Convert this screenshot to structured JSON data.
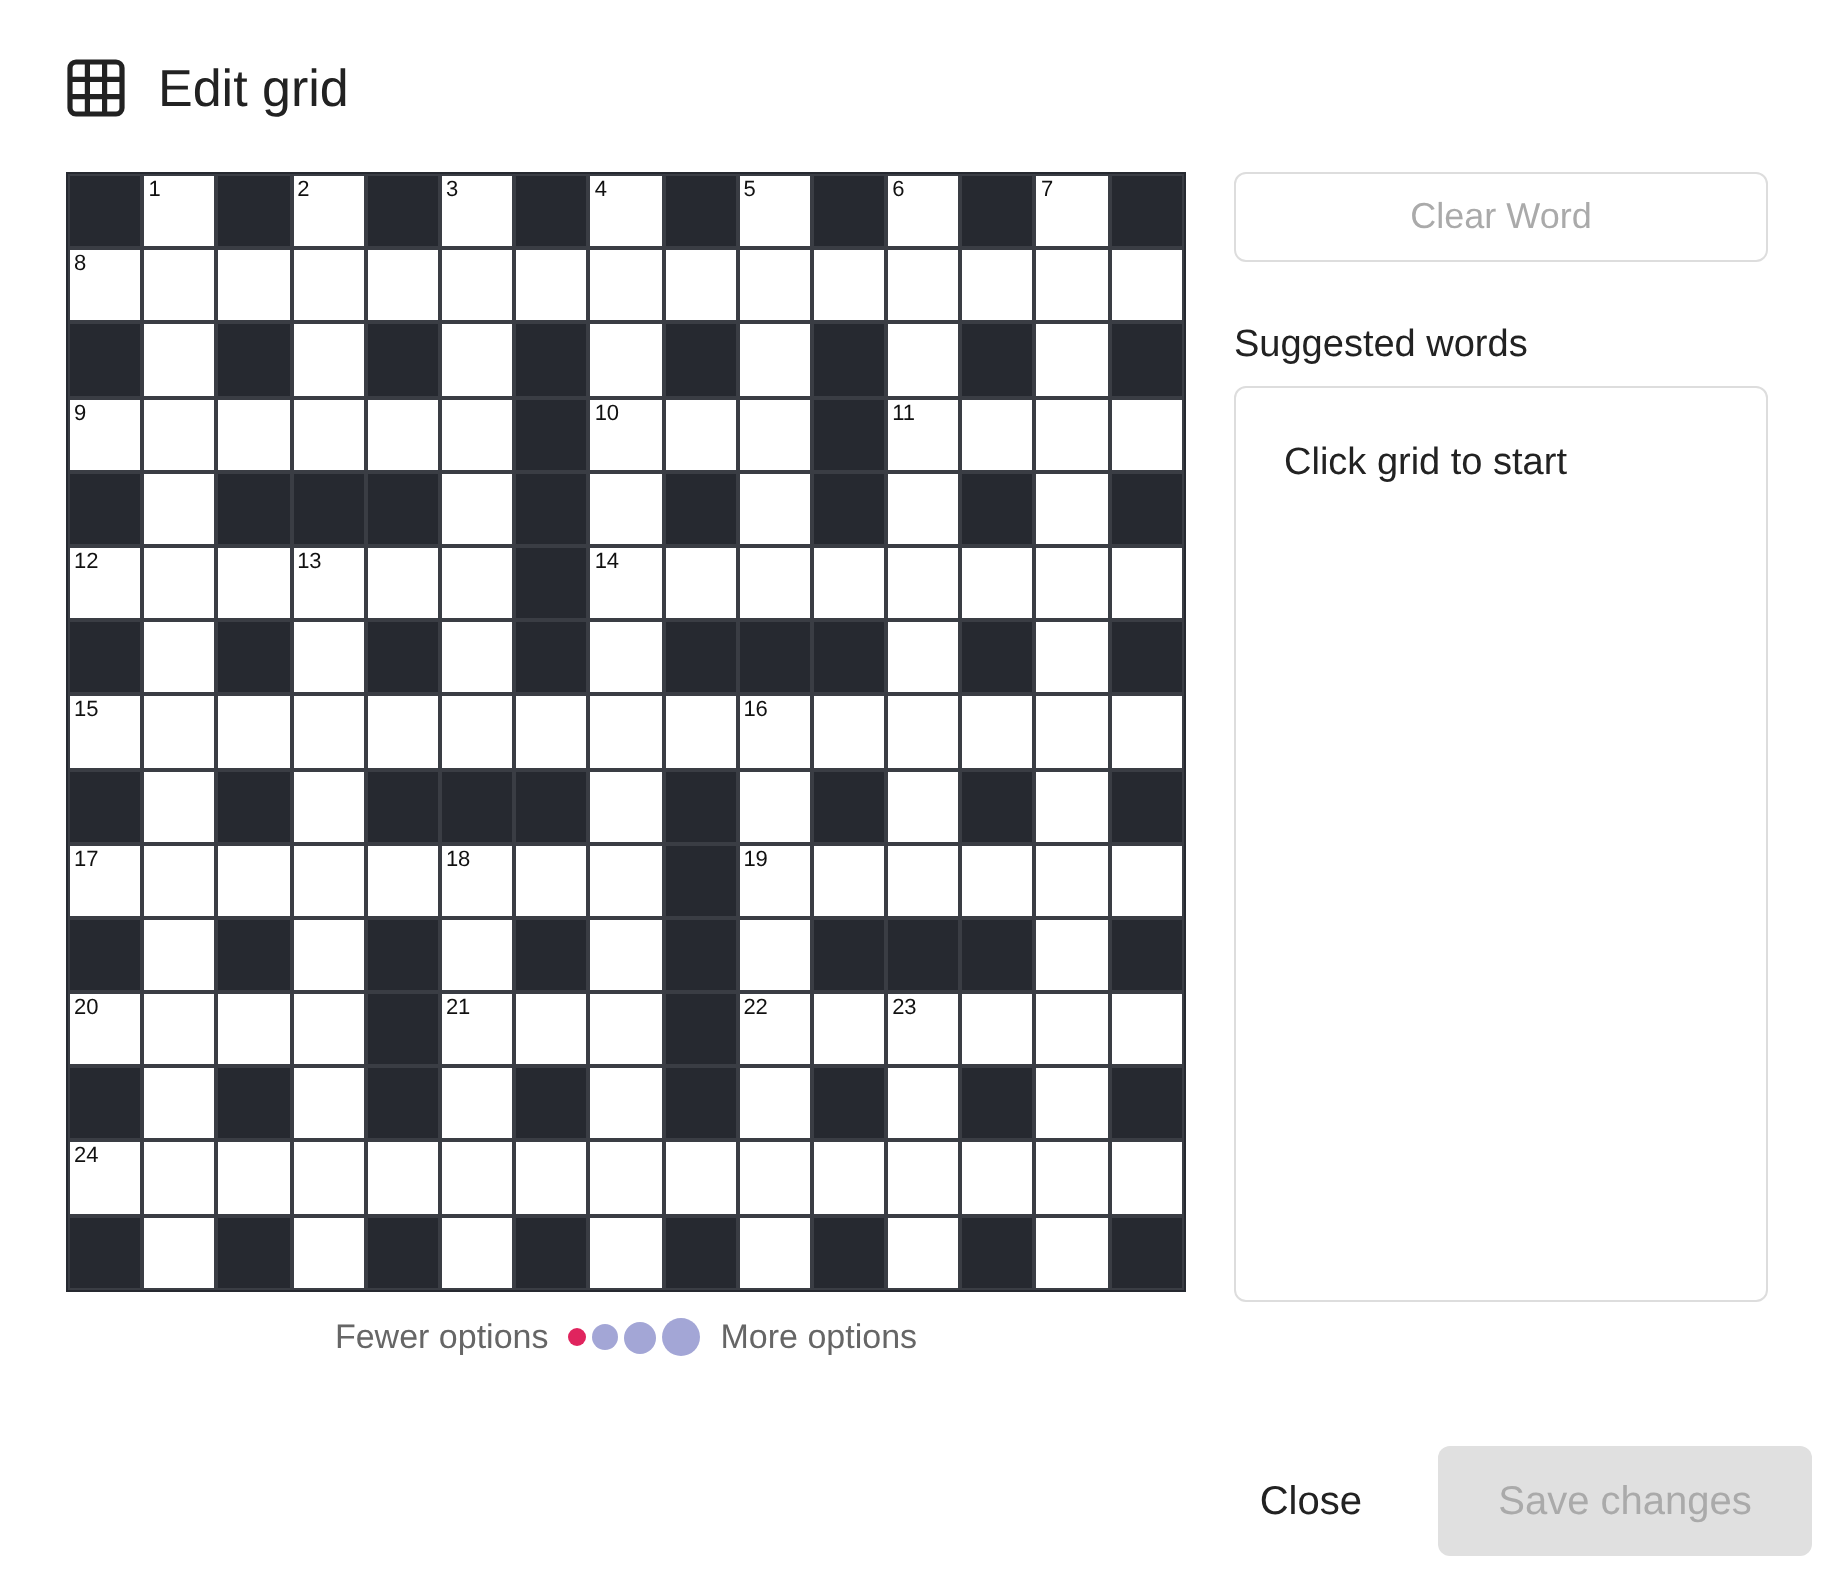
{
  "dialog": {
    "title": "Edit grid"
  },
  "grid": {
    "rows": [
      {
        "cells": [
          {
            "black": true
          },
          {
            "black": false,
            "number": "1"
          },
          {
            "black": true
          },
          {
            "black": false,
            "number": "2"
          },
          {
            "black": true
          },
          {
            "black": false,
            "number": "3"
          },
          {
            "black": true
          },
          {
            "black": false,
            "number": "4"
          },
          {
            "black": true
          },
          {
            "black": false,
            "number": "5"
          },
          {
            "black": true
          },
          {
            "black": false,
            "number": "6"
          },
          {
            "black": true
          },
          {
            "black": false,
            "number": "7"
          },
          {
            "black": true
          }
        ]
      },
      {
        "cells": [
          {
            "black": false,
            "number": "8"
          },
          {
            "black": false
          },
          {
            "black": false
          },
          {
            "black": false
          },
          {
            "black": false
          },
          {
            "black": false
          },
          {
            "black": false
          },
          {
            "black": false
          },
          {
            "black": false
          },
          {
            "black": false
          },
          {
            "black": false
          },
          {
            "black": false
          },
          {
            "black": false
          },
          {
            "black": false
          },
          {
            "black": false
          }
        ]
      },
      {
        "cells": [
          {
            "black": true
          },
          {
            "black": false
          },
          {
            "black": true
          },
          {
            "black": false
          },
          {
            "black": true
          },
          {
            "black": false
          },
          {
            "black": true
          },
          {
            "black": false
          },
          {
            "black": true
          },
          {
            "black": false
          },
          {
            "black": true
          },
          {
            "black": false
          },
          {
            "black": true
          },
          {
            "black": false
          },
          {
            "black": true
          }
        ]
      },
      {
        "cells": [
          {
            "black": false,
            "number": "9"
          },
          {
            "black": false
          },
          {
            "black": false
          },
          {
            "black": false
          },
          {
            "black": false
          },
          {
            "black": false
          },
          {
            "black": true
          },
          {
            "black": false,
            "number": "10"
          },
          {
            "black": false
          },
          {
            "black": false
          },
          {
            "black": true
          },
          {
            "black": false,
            "number": "11"
          },
          {
            "black": false
          },
          {
            "black": false
          },
          {
            "black": false
          }
        ]
      },
      {
        "cells": [
          {
            "black": true
          },
          {
            "black": false
          },
          {
            "black": true
          },
          {
            "black": true
          },
          {
            "black": true
          },
          {
            "black": false
          },
          {
            "black": true
          },
          {
            "black": false
          },
          {
            "black": true
          },
          {
            "black": false
          },
          {
            "black": true
          },
          {
            "black": false
          },
          {
            "black": true
          },
          {
            "black": false
          },
          {
            "black": true
          }
        ]
      },
      {
        "cells": [
          {
            "black": false,
            "number": "12"
          },
          {
            "black": false
          },
          {
            "black": false
          },
          {
            "black": false,
            "number": "13"
          },
          {
            "black": false
          },
          {
            "black": false
          },
          {
            "black": true
          },
          {
            "black": false,
            "number": "14"
          },
          {
            "black": false
          },
          {
            "black": false
          },
          {
            "black": false
          },
          {
            "black": false
          },
          {
            "black": false
          },
          {
            "black": false
          },
          {
            "black": false
          }
        ]
      },
      {
        "cells": [
          {
            "black": true
          },
          {
            "black": false
          },
          {
            "black": true
          },
          {
            "black": false
          },
          {
            "black": true
          },
          {
            "black": false
          },
          {
            "black": true
          },
          {
            "black": false
          },
          {
            "black": true
          },
          {
            "black": true
          },
          {
            "black": true
          },
          {
            "black": false
          },
          {
            "black": true
          },
          {
            "black": false
          },
          {
            "black": true
          }
        ]
      },
      {
        "cells": [
          {
            "black": false,
            "number": "15"
          },
          {
            "black": false
          },
          {
            "black": false
          },
          {
            "black": false
          },
          {
            "black": false
          },
          {
            "black": false
          },
          {
            "black": false
          },
          {
            "black": false
          },
          {
            "black": false
          },
          {
            "black": false,
            "number": "16"
          },
          {
            "black": false
          },
          {
            "black": false
          },
          {
            "black": false
          },
          {
            "black": false
          },
          {
            "black": false
          }
        ]
      },
      {
        "cells": [
          {
            "black": true
          },
          {
            "black": false
          },
          {
            "black": true
          },
          {
            "black": false
          },
          {
            "black": true
          },
          {
            "black": true
          },
          {
            "black": true
          },
          {
            "black": false
          },
          {
            "black": true
          },
          {
            "black": false
          },
          {
            "black": true
          },
          {
            "black": false
          },
          {
            "black": true
          },
          {
            "black": false
          },
          {
            "black": true
          }
        ]
      },
      {
        "cells": [
          {
            "black": false,
            "number": "17"
          },
          {
            "black": false
          },
          {
            "black": false
          },
          {
            "black": false
          },
          {
            "black": false
          },
          {
            "black": false,
            "number": "18"
          },
          {
            "black": false
          },
          {
            "black": false
          },
          {
            "black": true
          },
          {
            "black": false,
            "number": "19"
          },
          {
            "black": false
          },
          {
            "black": false
          },
          {
            "black": false
          },
          {
            "black": false
          },
          {
            "black": false
          }
        ]
      },
      {
        "cells": [
          {
            "black": true
          },
          {
            "black": false
          },
          {
            "black": true
          },
          {
            "black": false
          },
          {
            "black": true
          },
          {
            "black": false
          },
          {
            "black": true
          },
          {
            "black": false
          },
          {
            "black": true
          },
          {
            "black": false
          },
          {
            "black": true
          },
          {
            "black": true
          },
          {
            "black": true
          },
          {
            "black": false
          },
          {
            "black": true
          }
        ]
      },
      {
        "cells": [
          {
            "black": false,
            "number": "20"
          },
          {
            "black": false
          },
          {
            "black": false
          },
          {
            "black": false
          },
          {
            "black": true
          },
          {
            "black": false,
            "number": "21"
          },
          {
            "black": false
          },
          {
            "black": false
          },
          {
            "black": true
          },
          {
            "black": false,
            "number": "22"
          },
          {
            "black": false
          },
          {
            "black": false,
            "number": "23"
          },
          {
            "black": false
          },
          {
            "black": false
          },
          {
            "black": false
          }
        ]
      },
      {
        "cells": [
          {
            "black": true
          },
          {
            "black": false
          },
          {
            "black": true
          },
          {
            "black": false
          },
          {
            "black": true
          },
          {
            "black": false
          },
          {
            "black": true
          },
          {
            "black": false
          },
          {
            "black": true
          },
          {
            "black": false
          },
          {
            "black": true
          },
          {
            "black": false
          },
          {
            "black": true
          },
          {
            "black": false
          },
          {
            "black": true
          }
        ]
      },
      {
        "cells": [
          {
            "black": false,
            "number": "24"
          },
          {
            "black": false
          },
          {
            "black": false
          },
          {
            "black": false
          },
          {
            "black": false
          },
          {
            "black": false
          },
          {
            "black": false
          },
          {
            "black": false
          },
          {
            "black": false
          },
          {
            "black": false
          },
          {
            "black": false
          },
          {
            "black": false
          },
          {
            "black": false
          },
          {
            "black": false
          },
          {
            "black": false
          }
        ]
      },
      {
        "cells": [
          {
            "black": true
          },
          {
            "black": false
          },
          {
            "black": true
          },
          {
            "black": false
          },
          {
            "black": true
          },
          {
            "black": false
          },
          {
            "black": true
          },
          {
            "black": false
          },
          {
            "black": true
          },
          {
            "black": false
          },
          {
            "black": true
          },
          {
            "black": false
          },
          {
            "black": true
          },
          {
            "black": false
          },
          {
            "black": true
          }
        ]
      }
    ]
  },
  "legend": {
    "low_label": "Fewer options",
    "high_label": "More options",
    "dots": [
      {
        "color": "#e0245e"
      },
      {
        "color": "#a3a6d6"
      },
      {
        "color": "#a3a6d6"
      },
      {
        "color": "#a3a6d6"
      }
    ]
  },
  "clear_button": {
    "label": "Clear Word",
    "disabled": true
  },
  "suggestions": {
    "heading": "Suggested words",
    "placeholder": "Click grid to start"
  },
  "footer": {
    "buttons": [
      {
        "label": "Close",
        "kind": "link",
        "disabled": false
      },
      {
        "label": "Save changes",
        "kind": "primary",
        "disabled": true
      }
    ]
  }
}
